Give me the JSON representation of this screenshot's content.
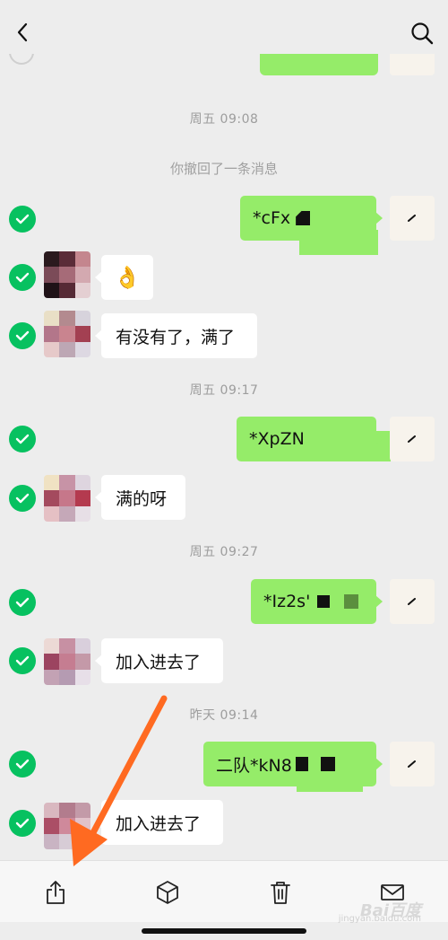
{
  "header": {
    "back_icon": "chevron-left-icon",
    "search_icon": "search-icon"
  },
  "messages": [
    {
      "kind": "timestamp",
      "text": "周五 09:08"
    },
    {
      "kind": "system",
      "text": "你撤回了一条消息"
    },
    {
      "kind": "outgoing",
      "text": "*cFx"
    },
    {
      "kind": "incoming",
      "text": "",
      "emoji": "👌"
    },
    {
      "kind": "incoming",
      "text": "有没有了，满了"
    },
    {
      "kind": "timestamp",
      "text": "周五 09:17"
    },
    {
      "kind": "outgoing",
      "text": "*XpZN"
    },
    {
      "kind": "incoming",
      "text": "满的呀"
    },
    {
      "kind": "timestamp",
      "text": "周五 09:27"
    },
    {
      "kind": "outgoing",
      "text": "*Iz2s'"
    },
    {
      "kind": "incoming",
      "text": "加入进去了"
    },
    {
      "kind": "timestamp",
      "text": "昨天 09:14"
    },
    {
      "kind": "outgoing",
      "text": "二队*kN8"
    },
    {
      "kind": "incoming",
      "text": "加入进去了"
    }
  ],
  "toolbar": {
    "share_icon": "share-icon",
    "favorite_icon": "cube-icon",
    "delete_icon": "trash-icon",
    "mail_icon": "mail-icon"
  },
  "watermark": {
    "text": "Bai百度",
    "sub": "jingyan.baidu.com"
  },
  "colors": {
    "background": "#ededed",
    "outgoing_bubble": "#95ec69",
    "incoming_bubble": "#ffffff",
    "check": "#07c160",
    "arrow": "#ff6a21"
  }
}
